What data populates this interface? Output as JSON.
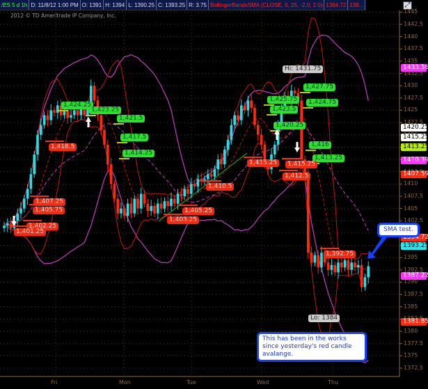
{
  "header": {
    "symbol": "/ES 5 d 1h",
    "date": "D: 11/8/12 1:00 PM",
    "open": "O: 1391",
    "high": "H: 1394",
    "low": "L: 1390.25",
    "close": "C: 1393.25",
    "range": "R: 3.75",
    "study": "BollingerBandsSMA (CLOSE, 0, 25, -2.0, 2.0)",
    "study_val1": "1394.72",
    "study_val2": "138..."
  },
  "copyright": "2012 © TD Ameritrade IP Company, Inc.",
  "colors": {
    "up": "#22e0e8",
    "down": "#ff2a10",
    "bb_short": "#c0180c",
    "bb_long": "#c040c0",
    "trend": "#1a9a1a",
    "accent": "#1540ff"
  },
  "chart_data": {
    "type": "candlestick",
    "title": "/ES 5 d 1h",
    "x_tick_labels": [
      "Fri",
      "Mon",
      "Tue",
      "Wed",
      "Thu"
    ],
    "y_ticks": [
      1372.5,
      1375,
      1377.5,
      1380,
      1382.5,
      1385,
      1387.5,
      1390,
      1392.5,
      1395,
      1397.5,
      1400,
      1402.5,
      1405,
      1407.5,
      1410,
      1412.5,
      1415,
      1417.5,
      1420,
      1422.5,
      1425,
      1427.5,
      1430,
      1432.5,
      1435,
      1437.5,
      1440,
      1442.5,
      1445
    ],
    "ylim": [
      1370,
      1445
    ],
    "closes": [
      1401.5,
      1402,
      1401,
      1402.5,
      1404,
      1405,
      1407,
      1409,
      1412,
      1416,
      1420,
      1422,
      1424,
      1423,
      1425,
      1424.5,
      1426,
      1424,
      1425,
      1423.5,
      1424,
      1425,
      1424,
      1425.5,
      1424,
      1426,
      1430,
      1427,
      1424,
      1421,
      1418,
      1414,
      1410,
      1407,
      1404,
      1405,
      1403.5,
      1406,
      1404,
      1407,
      1405,
      1408,
      1406,
      1404.5,
      1405.5,
      1404,
      1406,
      1405,
      1406.5,
      1405.5,
      1407,
      1406,
      1408,
      1407.5,
      1409,
      1408,
      1410,
      1409.5,
      1411,
      1410.5,
      1411,
      1412,
      1411.5,
      1413,
      1415,
      1414,
      1417,
      1419,
      1422,
      1424,
      1423,
      1426,
      1425,
      1427,
      1425.5,
      1422,
      1420,
      1418,
      1414,
      1413,
      1416,
      1418,
      1422,
      1425,
      1428,
      1427,
      1429,
      1428.5,
      1427,
      1415,
      1412,
      1396,
      1394,
      1395.5,
      1393,
      1396,
      1394,
      1392.5,
      1393.5,
      1392,
      1394,
      1393,
      1394.5,
      1392.5,
      1394,
      1393,
      1393.5,
      1389,
      1391,
      1393.25
    ],
    "price_badges": [
      {
        "text": "1433.56",
        "bg": "#ff33ff",
        "fg": "#fff"
      },
      {
        "text": "1420.25",
        "bg": "#fff",
        "fg": "#000"
      },
      {
        "text": "1415.25",
        "bg": "#fff",
        "fg": "#000"
      },
      {
        "text": "1413.25",
        "bg": "#bbee00",
        "fg": "#000"
      },
      {
        "text": "1410.39",
        "bg": "#ff33ff",
        "fg": "#fff"
      },
      {
        "text": "1407.59",
        "bg": "#ff2a10",
        "fg": "#fff"
      },
      {
        "text": "1394.72",
        "bg": "#ff2a10",
        "fg": "#fff"
      },
      {
        "text": "1393.25",
        "bg": "#22e8f0",
        "fg": "#000"
      },
      {
        "text": "1387.22",
        "bg": "#ff33ff",
        "fg": "#fff"
      },
      {
        "text": "1381.85",
        "bg": "#ff2a10",
        "fg": "#fff"
      }
    ],
    "green_labels": [
      "1,424.25",
      "1,423.25",
      "1,421.5",
      "1,417.5",
      "1,414.25",
      "1,425.75",
      "1,427.75",
      "1,424.75",
      "1,423.5",
      "1,420.25",
      "1,416",
      "1,413.25"
    ],
    "red_labels": [
      "1,418.5",
      "1,407.25",
      "1,405.75",
      "1,402.25",
      "1,401.25",
      "1,410.5",
      "1,405.25",
      "1,403.25",
      "1,415.25",
      "1,415.25",
      "1,412.5",
      "1,392.75"
    ],
    "hi_label": "Hi: 1431.75",
    "lo_label": "Lo: 1384",
    "annotations": [
      "SMA test.",
      "This has been in the works since yesterday's red candle avalange."
    ]
  }
}
